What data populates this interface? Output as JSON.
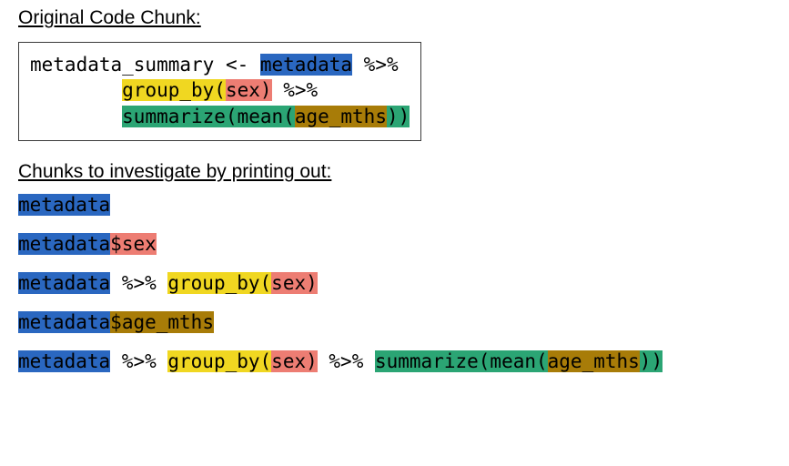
{
  "headings": {
    "original": "Original Code Chunk:",
    "investigate": "Chunks to investigate by printing out:"
  },
  "tokens": {
    "assign_var": "metadata_summary",
    "assign_op": " <- ",
    "metadata": "metadata",
    "pipe_spaced": " %>%",
    "pipe_spaced2": " %>% ",
    "indent": "        ",
    "group_by_open": "group_by(",
    "sex": "sex",
    "close_paren": ")",
    "summarize_open": "summarize(",
    "mean_open": "mean(",
    "age_mths": "age_mths",
    "double_close_green": "))",
    "dollar": "$",
    "sp": " "
  }
}
